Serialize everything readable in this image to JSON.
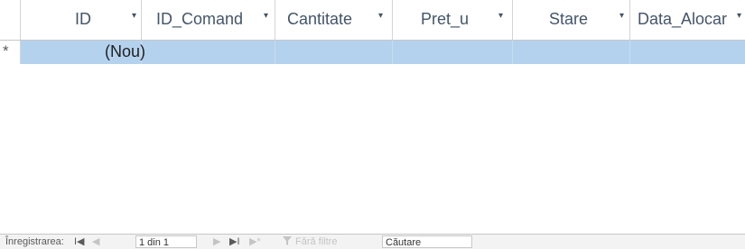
{
  "columns": [
    {
      "label": "ID"
    },
    {
      "label": "ID_Comand"
    },
    {
      "label": "Cantitate"
    },
    {
      "label": "Pret_u"
    },
    {
      "label": "Stare"
    },
    {
      "label": "Data_Alocar"
    }
  ],
  "new_row": {
    "marker": "*",
    "id_value": "(Nou)"
  },
  "navigation": {
    "record_label": "Înregistrarea:",
    "first_symbol": "I◀",
    "prev_symbol": "◀",
    "position": "1 din 1",
    "next_symbol": "▶",
    "last_symbol": "▶I",
    "new_symbol": "▶*",
    "filter_label": "Fără filtre",
    "search_label": "Căutare"
  },
  "colors": {
    "selection": "#b4d2ee",
    "header_text": "#44546a"
  }
}
